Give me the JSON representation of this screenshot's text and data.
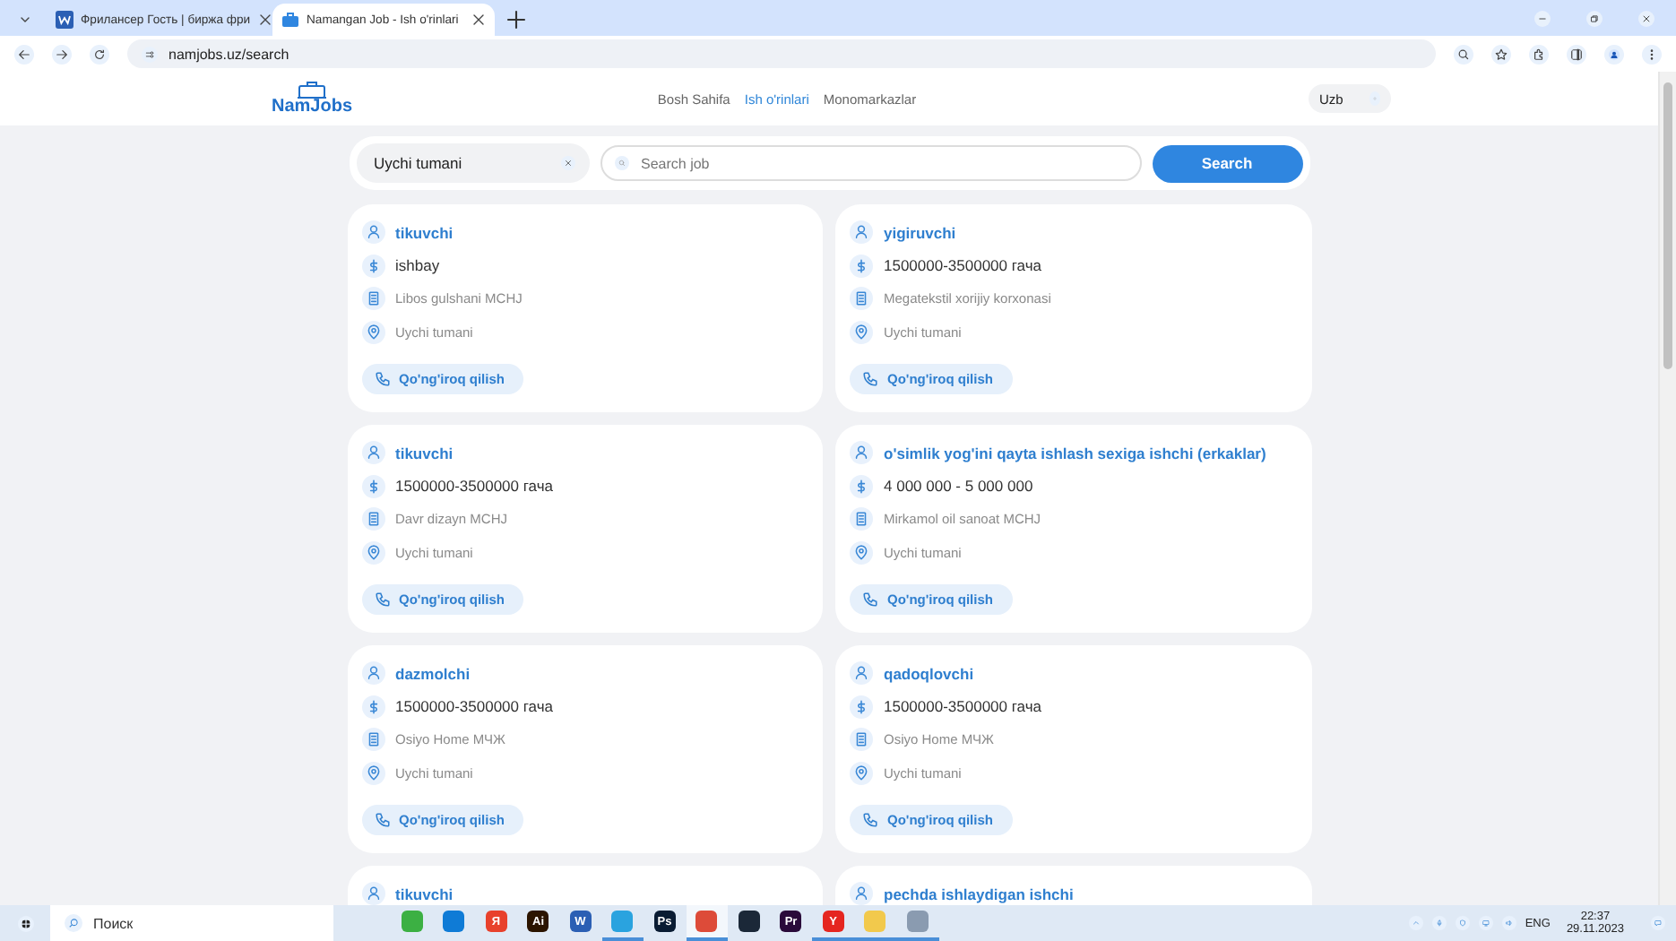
{
  "browser": {
    "tabs": [
      {
        "title": "Фрилансер Гость | биржа фри",
        "selected": false,
        "kind": "doc"
      },
      {
        "title": "Namangan Job - Ish o'rinlari",
        "selected": true,
        "kind": "case"
      }
    ],
    "url": "namjobs.uz/search"
  },
  "header": {
    "logo": "NamJobs",
    "nav": [
      {
        "label": "Bosh Sahifa",
        "selected": false
      },
      {
        "label": "Ish o'rinlari",
        "selected": true
      },
      {
        "label": "Monomarkazlar",
        "selected": false
      }
    ],
    "language": "Uzb"
  },
  "search": {
    "region": "Uychi tumani",
    "placeholder": "Search job",
    "button": "Search"
  },
  "jobs": [
    {
      "title": "tikuvchi",
      "salary": "ishbay",
      "company": "Libos gulshani MCHJ",
      "location": "Uychi tumani",
      "action": "Qo'ng'iroq qilish"
    },
    {
      "title": "yigiruvchi",
      "salary": "1500000-3500000 гача",
      "company": "Megatekstil xorijiy korxonasi",
      "location": "Uychi tumani",
      "action": "Qo'ng'iroq qilish"
    },
    {
      "title": "tikuvchi",
      "salary": "1500000-3500000 гача",
      "company": "Davr dizayn MCHJ",
      "location": "Uychi tumani",
      "action": "Qo'ng'iroq qilish"
    },
    {
      "title": "o'simlik yog'ini qayta ishlash sexiga ishchi (erkaklar)",
      "salary": "4 000 000 - 5 000 000",
      "company": "Mirkamol oil sanoat MCHJ",
      "location": "Uychi tumani",
      "action": "Qo'ng'iroq qilish"
    },
    {
      "title": "dazmolchi",
      "salary": "1500000-3500000 гача",
      "company": "Osiyo Home МЧЖ",
      "location": "Uychi tumani",
      "action": "Qo'ng'iroq qilish"
    },
    {
      "title": "qadoqlovchi",
      "salary": "1500000-3500000 гача",
      "company": "Osiyo Home МЧЖ",
      "location": "Uychi tumani",
      "action": "Qo'ng'iroq qilish"
    },
    {
      "title": "tikuvchi"
    },
    {
      "title": "pechda ishlaydigan ishchi"
    }
  ],
  "taskbar": {
    "search_placeholder": "Поиск",
    "apps": [
      {
        "color": "#3cb043",
        "running": false,
        "selected": false
      },
      {
        "color": "#0f7bd6",
        "running": false,
        "selected": false
      },
      {
        "glyph": "Я",
        "color": "#e8412c",
        "running": false,
        "selected": false
      },
      {
        "glyph": "Ai",
        "color": "#2b1400",
        "running": false,
        "selected": false
      },
      {
        "glyph": "W",
        "color": "#2b5fb4",
        "running": false,
        "selected": false
      },
      {
        "color": "#2aa3df",
        "running": true,
        "selected": false
      },
      {
        "glyph": "Ps",
        "color": "#0a1c33",
        "running": false,
        "selected": false
      },
      {
        "color": "#dd4b39",
        "running": true,
        "selected": true
      },
      {
        "color": "#1b2838",
        "running": false,
        "selected": false
      },
      {
        "glyph": "Pr",
        "color": "#2a0a3a",
        "running": false,
        "selected": false
      },
      {
        "glyph": "Y",
        "color": "#e52620",
        "running": true,
        "selected": false
      },
      {
        "color": "#f2c94c",
        "running": true,
        "selected": false
      },
      {
        "color": "#8a9bb0",
        "running": true,
        "selected": false
      }
    ],
    "language": "ENG",
    "time": "22:37",
    "date": "29.11.2023"
  }
}
